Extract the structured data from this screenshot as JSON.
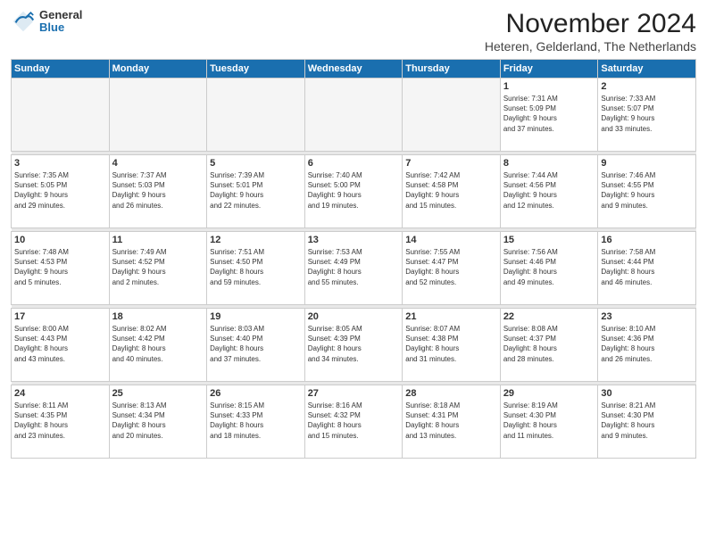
{
  "logo": {
    "line1": "General",
    "line2": "Blue"
  },
  "title": "November 2024",
  "location": "Heteren, Gelderland, The Netherlands",
  "weekdays": [
    "Sunday",
    "Monday",
    "Tuesday",
    "Wednesday",
    "Thursday",
    "Friday",
    "Saturday"
  ],
  "weeks": [
    [
      {
        "day": "",
        "info": ""
      },
      {
        "day": "",
        "info": ""
      },
      {
        "day": "",
        "info": ""
      },
      {
        "day": "",
        "info": ""
      },
      {
        "day": "",
        "info": ""
      },
      {
        "day": "1",
        "info": "Sunrise: 7:31 AM\nSunset: 5:09 PM\nDaylight: 9 hours\nand 37 minutes."
      },
      {
        "day": "2",
        "info": "Sunrise: 7:33 AM\nSunset: 5:07 PM\nDaylight: 9 hours\nand 33 minutes."
      }
    ],
    [
      {
        "day": "3",
        "info": "Sunrise: 7:35 AM\nSunset: 5:05 PM\nDaylight: 9 hours\nand 29 minutes."
      },
      {
        "day": "4",
        "info": "Sunrise: 7:37 AM\nSunset: 5:03 PM\nDaylight: 9 hours\nand 26 minutes."
      },
      {
        "day": "5",
        "info": "Sunrise: 7:39 AM\nSunset: 5:01 PM\nDaylight: 9 hours\nand 22 minutes."
      },
      {
        "day": "6",
        "info": "Sunrise: 7:40 AM\nSunset: 5:00 PM\nDaylight: 9 hours\nand 19 minutes."
      },
      {
        "day": "7",
        "info": "Sunrise: 7:42 AM\nSunset: 4:58 PM\nDaylight: 9 hours\nand 15 minutes."
      },
      {
        "day": "8",
        "info": "Sunrise: 7:44 AM\nSunset: 4:56 PM\nDaylight: 9 hours\nand 12 minutes."
      },
      {
        "day": "9",
        "info": "Sunrise: 7:46 AM\nSunset: 4:55 PM\nDaylight: 9 hours\nand 9 minutes."
      }
    ],
    [
      {
        "day": "10",
        "info": "Sunrise: 7:48 AM\nSunset: 4:53 PM\nDaylight: 9 hours\nand 5 minutes."
      },
      {
        "day": "11",
        "info": "Sunrise: 7:49 AM\nSunset: 4:52 PM\nDaylight: 9 hours\nand 2 minutes."
      },
      {
        "day": "12",
        "info": "Sunrise: 7:51 AM\nSunset: 4:50 PM\nDaylight: 8 hours\nand 59 minutes."
      },
      {
        "day": "13",
        "info": "Sunrise: 7:53 AM\nSunset: 4:49 PM\nDaylight: 8 hours\nand 55 minutes."
      },
      {
        "day": "14",
        "info": "Sunrise: 7:55 AM\nSunset: 4:47 PM\nDaylight: 8 hours\nand 52 minutes."
      },
      {
        "day": "15",
        "info": "Sunrise: 7:56 AM\nSunset: 4:46 PM\nDaylight: 8 hours\nand 49 minutes."
      },
      {
        "day": "16",
        "info": "Sunrise: 7:58 AM\nSunset: 4:44 PM\nDaylight: 8 hours\nand 46 minutes."
      }
    ],
    [
      {
        "day": "17",
        "info": "Sunrise: 8:00 AM\nSunset: 4:43 PM\nDaylight: 8 hours\nand 43 minutes."
      },
      {
        "day": "18",
        "info": "Sunrise: 8:02 AM\nSunset: 4:42 PM\nDaylight: 8 hours\nand 40 minutes."
      },
      {
        "day": "19",
        "info": "Sunrise: 8:03 AM\nSunset: 4:40 PM\nDaylight: 8 hours\nand 37 minutes."
      },
      {
        "day": "20",
        "info": "Sunrise: 8:05 AM\nSunset: 4:39 PM\nDaylight: 8 hours\nand 34 minutes."
      },
      {
        "day": "21",
        "info": "Sunrise: 8:07 AM\nSunset: 4:38 PM\nDaylight: 8 hours\nand 31 minutes."
      },
      {
        "day": "22",
        "info": "Sunrise: 8:08 AM\nSunset: 4:37 PM\nDaylight: 8 hours\nand 28 minutes."
      },
      {
        "day": "23",
        "info": "Sunrise: 8:10 AM\nSunset: 4:36 PM\nDaylight: 8 hours\nand 26 minutes."
      }
    ],
    [
      {
        "day": "24",
        "info": "Sunrise: 8:11 AM\nSunset: 4:35 PM\nDaylight: 8 hours\nand 23 minutes."
      },
      {
        "day": "25",
        "info": "Sunrise: 8:13 AM\nSunset: 4:34 PM\nDaylight: 8 hours\nand 20 minutes."
      },
      {
        "day": "26",
        "info": "Sunrise: 8:15 AM\nSunset: 4:33 PM\nDaylight: 8 hours\nand 18 minutes."
      },
      {
        "day": "27",
        "info": "Sunrise: 8:16 AM\nSunset: 4:32 PM\nDaylight: 8 hours\nand 15 minutes."
      },
      {
        "day": "28",
        "info": "Sunrise: 8:18 AM\nSunset: 4:31 PM\nDaylight: 8 hours\nand 13 minutes."
      },
      {
        "day": "29",
        "info": "Sunrise: 8:19 AM\nSunset: 4:30 PM\nDaylight: 8 hours\nand 11 minutes."
      },
      {
        "day": "30",
        "info": "Sunrise: 8:21 AM\nSunset: 4:30 PM\nDaylight: 8 hours\nand 9 minutes."
      }
    ]
  ]
}
